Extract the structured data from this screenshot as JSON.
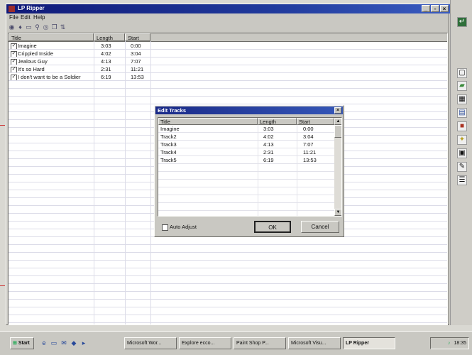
{
  "window": {
    "title": "LP Ripper",
    "controls": [
      "_",
      "▫",
      "×"
    ]
  },
  "menu": [
    "File",
    "Edit",
    "Help"
  ],
  "list": {
    "columns": [
      "Title",
      "Length",
      "Start"
    ],
    "rows": [
      {
        "title": "Imagine",
        "length": "3:03",
        "start": "0:00",
        "checked": true
      },
      {
        "title": "Crippled Inside",
        "length": "4:02",
        "start": "3:04",
        "checked": true
      },
      {
        "title": "Jealous Guy",
        "length": "4:13",
        "start": "7:07",
        "checked": true
      },
      {
        "title": "It's so Hard",
        "length": "2:31",
        "start": "11:21",
        "checked": true
      },
      {
        "title": "I don't want to be a Soldier",
        "length": "6:19",
        "start": "13:53",
        "checked": true
      }
    ]
  },
  "dialog": {
    "title": "Edit Tracks",
    "columns": [
      "Title",
      "Length",
      "Start"
    ],
    "rows": [
      {
        "title": "Imagine",
        "length": "3:03",
        "start": "0:00"
      },
      {
        "title": "Track2",
        "length": "4:02",
        "start": "3:04"
      },
      {
        "title": "Track3",
        "length": "4:13",
        "start": "7:07"
      },
      {
        "title": "Track4",
        "length": "2:31",
        "start": "11:21"
      },
      {
        "title": "Track5",
        "length": "6:19",
        "start": "13:53"
      }
    ],
    "auto_adjust_label": "Auto Adjust",
    "ok_label": "OK",
    "cancel_label": "Cancel"
  },
  "taskbar": {
    "start_label": "Start",
    "tasks": [
      "Microsoft Wor...",
      "Explore ecco...",
      "Paint Shop P...",
      "Microsoft Visu...",
      "LP Ripper"
    ],
    "clock": "18:35"
  }
}
